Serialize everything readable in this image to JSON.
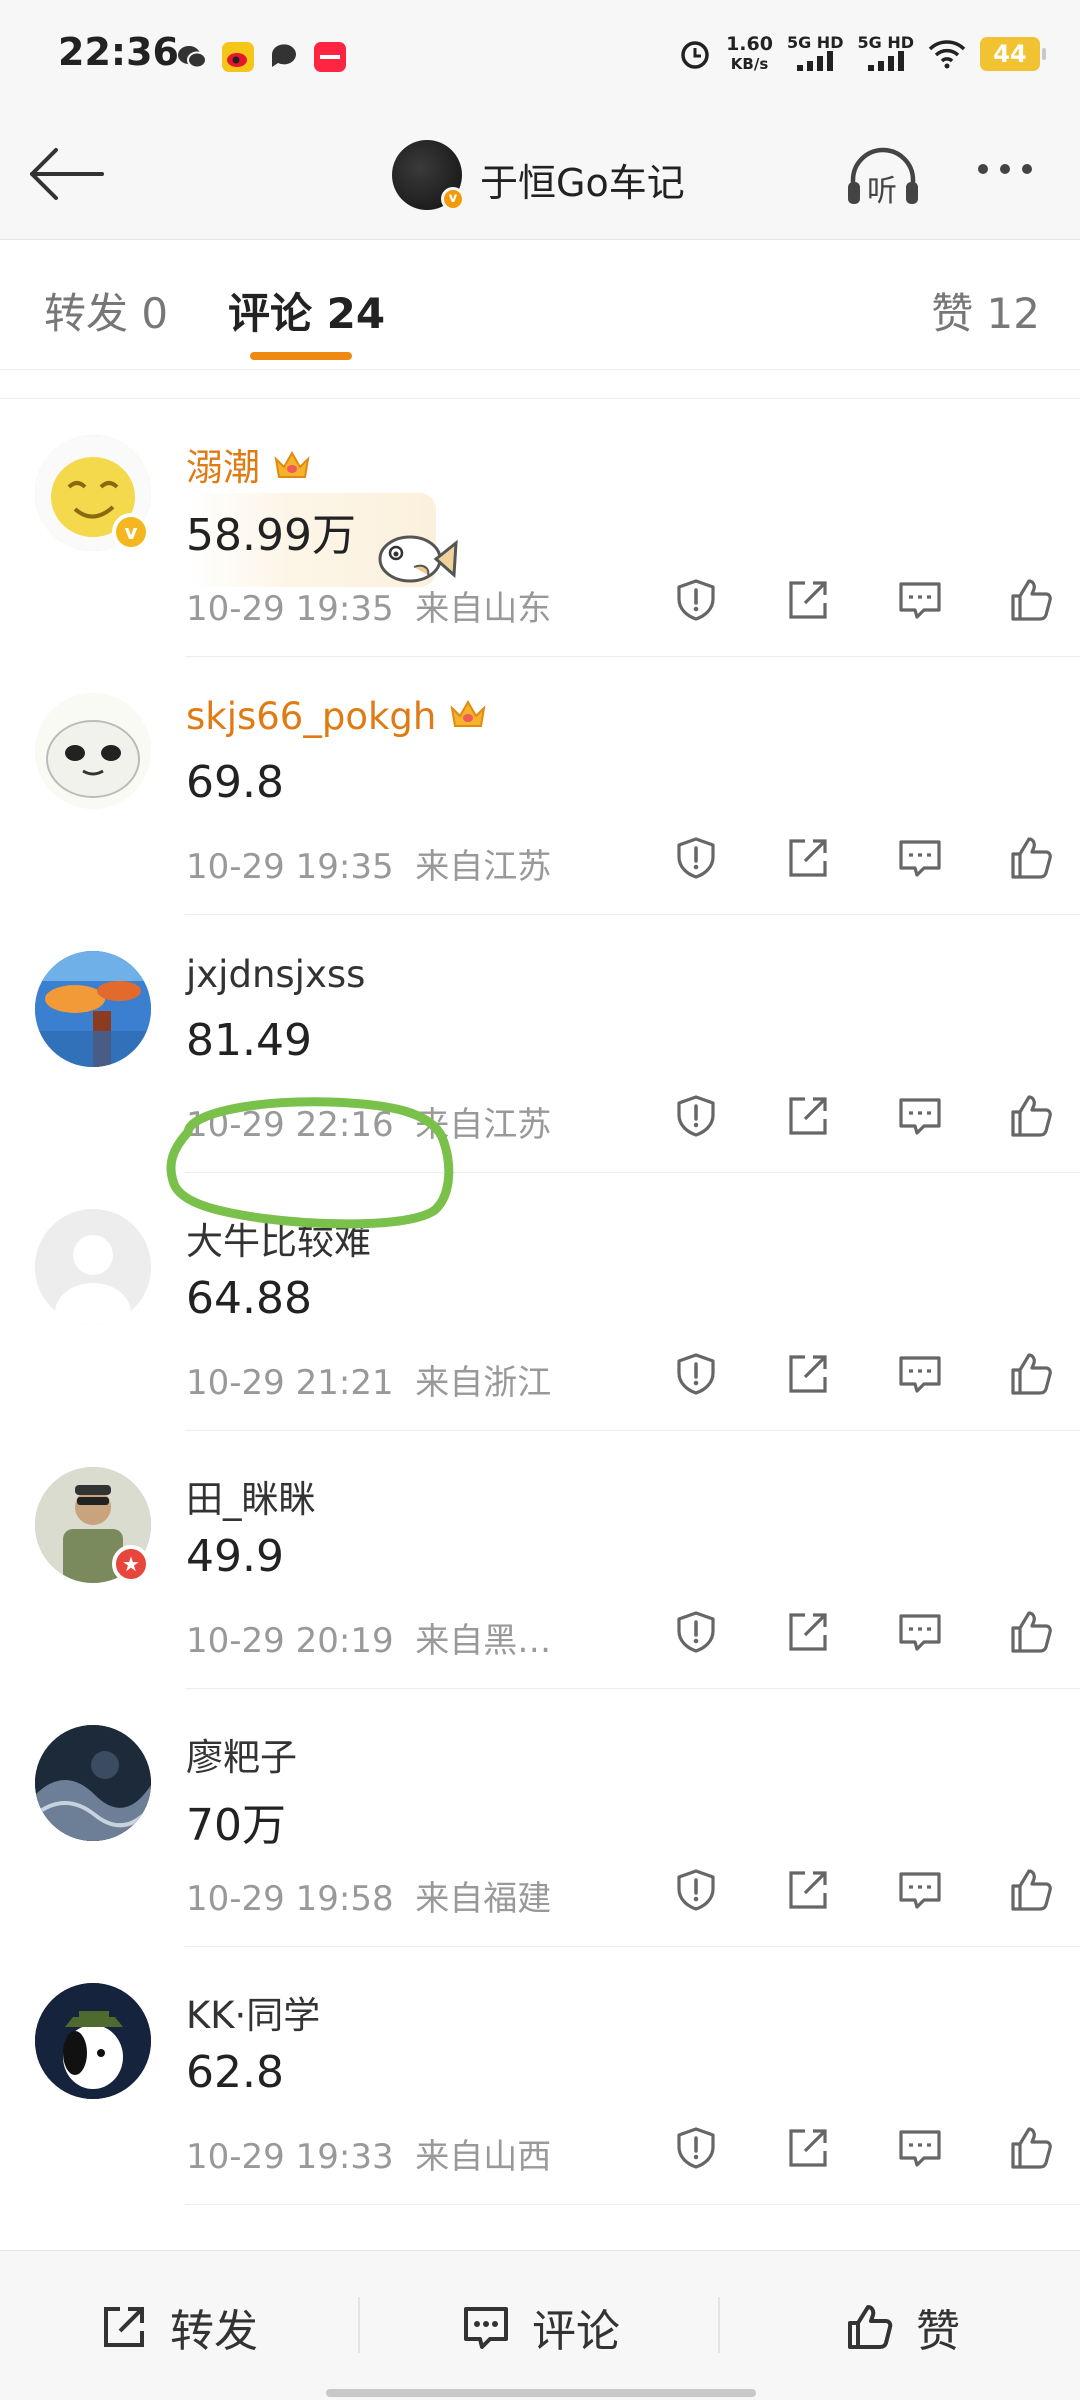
{
  "status_bar": {
    "time": "22:36",
    "speed_value": "1.60",
    "speed_unit": "KB/s",
    "sim1": "5G HD",
    "sim2": "5G HD",
    "battery": "44",
    "notification_icons": [
      "wechat-icon",
      "weibo-icon",
      "chat-icon",
      "xiaohongshu-icon"
    ]
  },
  "header": {
    "title": "于恒Go车记",
    "listen_label": "听",
    "verified_mark": "v"
  },
  "tabs": [
    {
      "label": "转发 0",
      "active": false
    },
    {
      "label": "评论 24",
      "active": true
    },
    {
      "label": "赞 12",
      "active": false
    }
  ],
  "comments": [
    {
      "name": "溺潮",
      "gold": true,
      "crown": true,
      "badge": "v",
      "badge_color": "#f5b71f",
      "text": "58.99万",
      "time": "10-29 19:35",
      "location": "来自山东",
      "sticker": true,
      "avatar_bg": "#f4d94c"
    },
    {
      "name": "skjs66_pokgh",
      "gold": true,
      "crown": true,
      "badge": "",
      "badge_color": "",
      "text": "69.8",
      "time": "10-29 19:35",
      "location": "来自江苏",
      "sticker": false,
      "avatar_bg": "#f2f2ec"
    },
    {
      "name": "jxjdnsjxss",
      "gold": false,
      "crown": false,
      "badge": "",
      "badge_color": "",
      "text": "81.49",
      "time": "10-29 22:16",
      "location": "来自江苏",
      "sticker": false,
      "avatar_bg": "#3b7fd0"
    },
    {
      "name": "大牛比较难",
      "gold": false,
      "crown": false,
      "badge": "",
      "badge_color": "",
      "text": "64.88",
      "time": "10-29 21:21",
      "location": "来自浙江",
      "sticker": false,
      "avatar_bg": "#ededed"
    },
    {
      "name": "田_眯眯",
      "gold": false,
      "crown": false,
      "badge": "★",
      "badge_color": "#e8453c",
      "text": "49.9",
      "time": "10-29 20:19",
      "location": "来自黑…",
      "sticker": false,
      "avatar_bg": "#a2a58b"
    },
    {
      "name": "廖粑子",
      "gold": false,
      "crown": false,
      "badge": "",
      "badge_color": "",
      "text": "70万",
      "time": "10-29 19:58",
      "location": "来自福建",
      "sticker": false,
      "avatar_bg": "#1d2a3a"
    },
    {
      "name": "KK·同学",
      "gold": false,
      "crown": false,
      "badge": "",
      "badge_color": "",
      "text": "62.8",
      "time": "10-29 19:33",
      "location": "来自山西",
      "sticker": false,
      "avatar_bg": "#16233d"
    }
  ],
  "bottom_bar": {
    "repost": "转发",
    "comment": "评论",
    "like": "赞"
  },
  "colors": {
    "accent": "#ee8a0f",
    "gold_name": "#e07b14",
    "annotation_green": "#79c14a"
  }
}
